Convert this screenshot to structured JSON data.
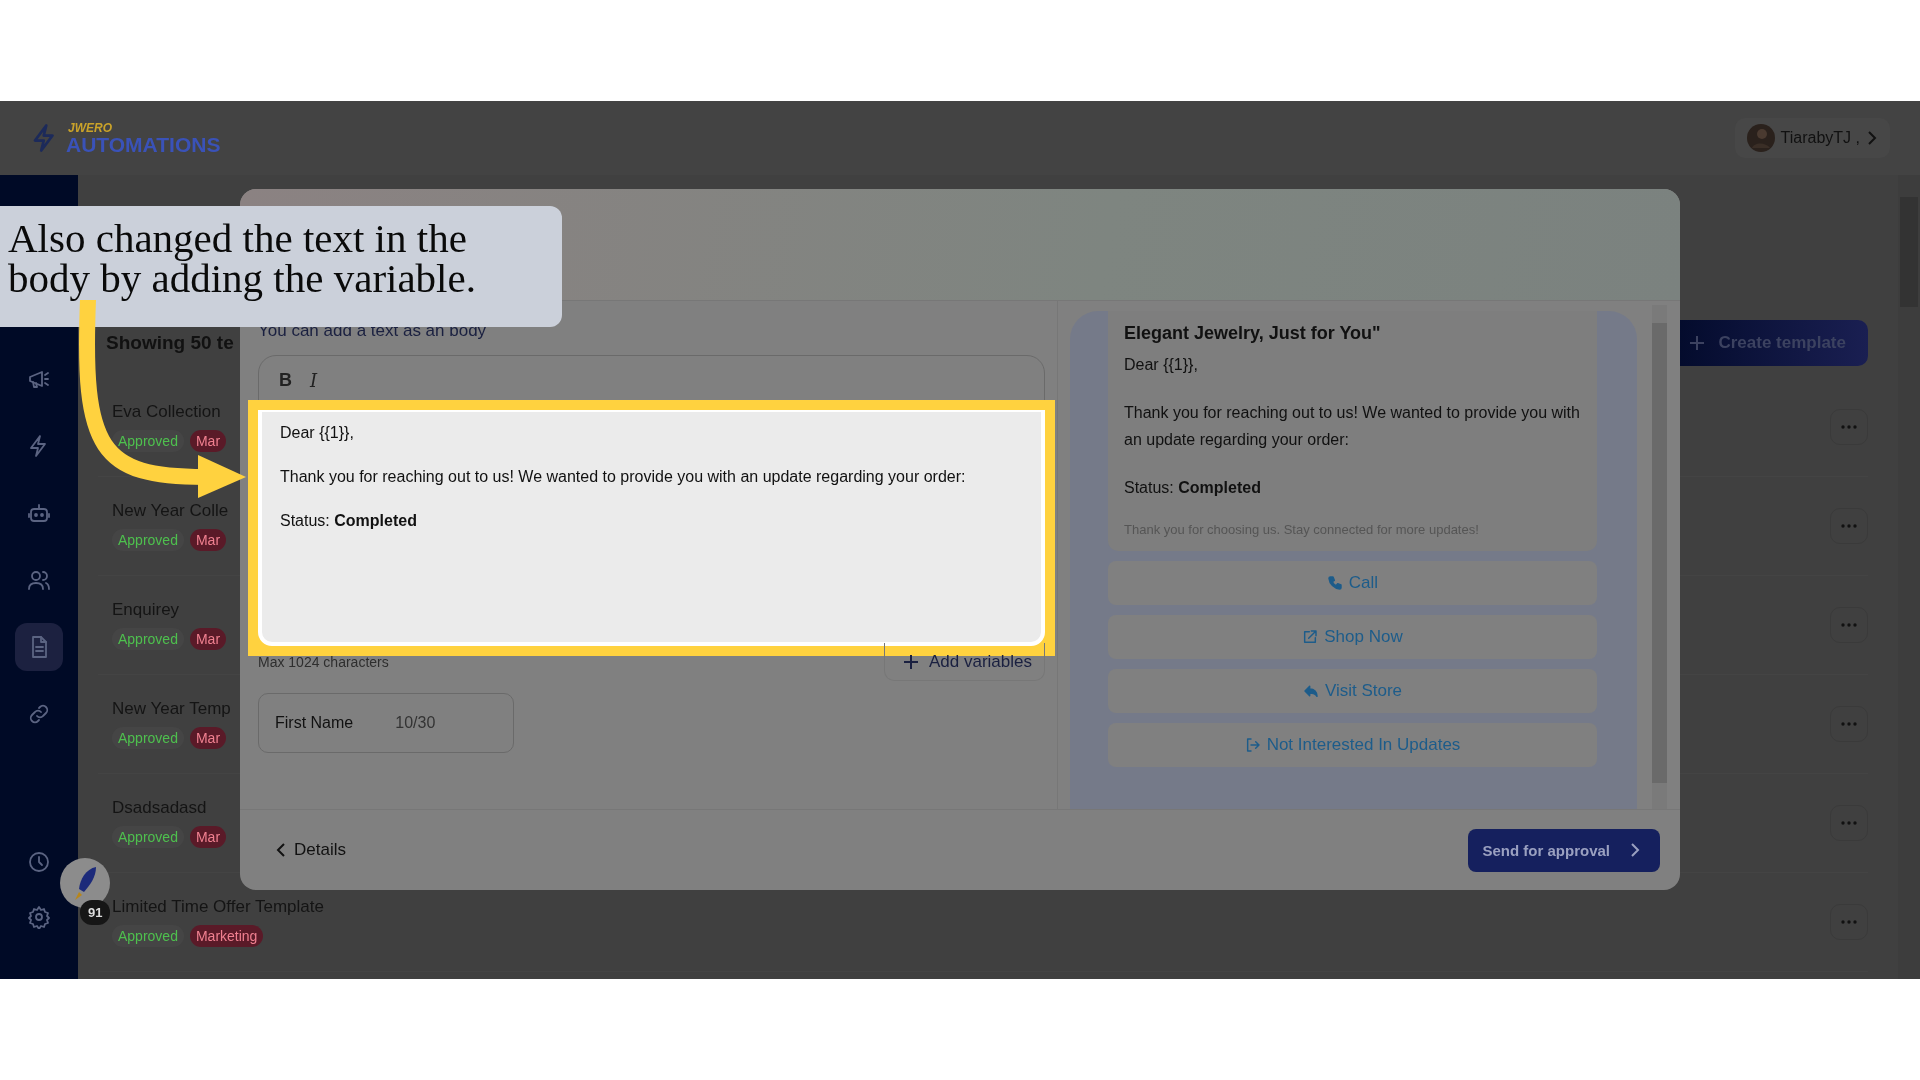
{
  "header": {
    "logo_super": "JWERO",
    "logo": "AUTOMATIONS",
    "user": "TiarabyTJ ,"
  },
  "sidebar": {
    "items": [
      {
        "kind": "megaphone",
        "selected": false
      },
      {
        "kind": "bolt",
        "selected": false
      },
      {
        "kind": "robot",
        "selected": false
      },
      {
        "kind": "users",
        "selected": false
      },
      {
        "kind": "document",
        "selected": true
      },
      {
        "kind": "link",
        "selected": false
      },
      {
        "kind": "clock",
        "selected": false
      },
      {
        "kind": "gear",
        "selected": false
      }
    ]
  },
  "templates": {
    "heading": "Showing 50 te",
    "create_button": "Create template",
    "rows": [
      {
        "name": "Eva Collection",
        "status": "Approved",
        "category": "Mar"
      },
      {
        "name": "New Year Colle",
        "status": "Approved",
        "category": "Mar"
      },
      {
        "name": "Enquirey",
        "status": "Approved",
        "category": "Mar"
      },
      {
        "name": "New Year Temp",
        "status": "Approved",
        "category": "Mar"
      },
      {
        "name": "Dsadsadasd",
        "status": "Approved",
        "category": "Mar"
      },
      {
        "name": "Limited Time Offer Template",
        "status": "Approved",
        "category": "Marketing"
      }
    ]
  },
  "launcher": {
    "badge": "91"
  },
  "modal": {
    "body_hint": "You can add a text as an body",
    "toolbar": [
      {
        "kind": "bold",
        "label": "B"
      },
      {
        "kind": "italic",
        "label": "I"
      }
    ],
    "body_lines": [
      "Dear {{1}},",
      "Thank you for reaching out to us! We wanted to provide you with an update regarding your order:",
      "Status: **Completed**"
    ],
    "limit": "Max 1024 characters",
    "add_variables": "Add variables",
    "variables": [
      {
        "value": "First Name",
        "count": "10/30"
      }
    ],
    "preview": {
      "title": "Elegant Jewelry, Just for You\"",
      "lines": [
        "Dear {{1}},",
        "Thank you for reaching out to us! We wanted to provide you with an update regarding your order:",
        "Status: **Completed**"
      ],
      "footer": "Thank you for choosing us. Stay connected for more updates!",
      "buttons": [
        {
          "kind": "call",
          "label": "Call"
        },
        {
          "kind": "url",
          "label": "Shop Now"
        },
        {
          "kind": "reply",
          "label": "Visit Store"
        },
        {
          "kind": "optout",
          "label": "Not Interested In Updates"
        }
      ]
    },
    "back": "Details",
    "submit": "Send for approval"
  },
  "callout": {
    "text": "Also changed the text in the body by adding the variable."
  }
}
